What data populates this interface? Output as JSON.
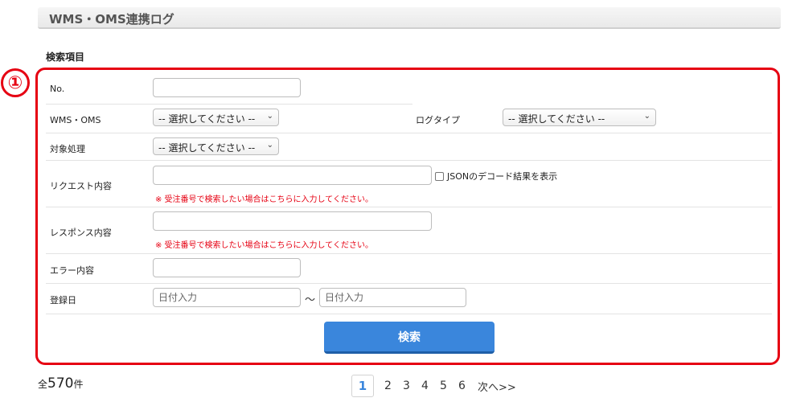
{
  "header": {
    "title": "WMS・OMS連携ログ"
  },
  "section": {
    "label": "検索項目"
  },
  "annotation": {
    "marker": "①",
    "color": "#e60012"
  },
  "form": {
    "no_label": "No.",
    "wms_oms_label": "WMS・OMS",
    "wms_oms_value": "-- 選択してください --",
    "log_type_label": "ログタイプ",
    "log_type_value": "-- 選択してください --",
    "target_label": "対象処理",
    "target_value": "-- 選択してください --",
    "request_label": "リクエスト内容",
    "request_note": "※ 受注番号で検索したい場合はこちらに入力してください。",
    "json_decode_label": "JSONのデコード結果を表示",
    "response_label": "レスポンス内容",
    "response_note": "※ 受注番号で検索したい場合はこちらに入力してください。",
    "error_label": "エラー内容",
    "date_label": "登録日",
    "date_from_placeholder": "日付入力",
    "date_separator": "～",
    "date_to_placeholder": "日付入力",
    "search_button": "検索"
  },
  "results": {
    "prefix": "全",
    "count": "570",
    "suffix": "件"
  },
  "pagination": {
    "current": "1",
    "pages": [
      "2",
      "3",
      "4",
      "5",
      "6"
    ],
    "next": "次へ>>"
  },
  "colors": {
    "accent": "#3a86dc",
    "alert": "#e60012"
  }
}
